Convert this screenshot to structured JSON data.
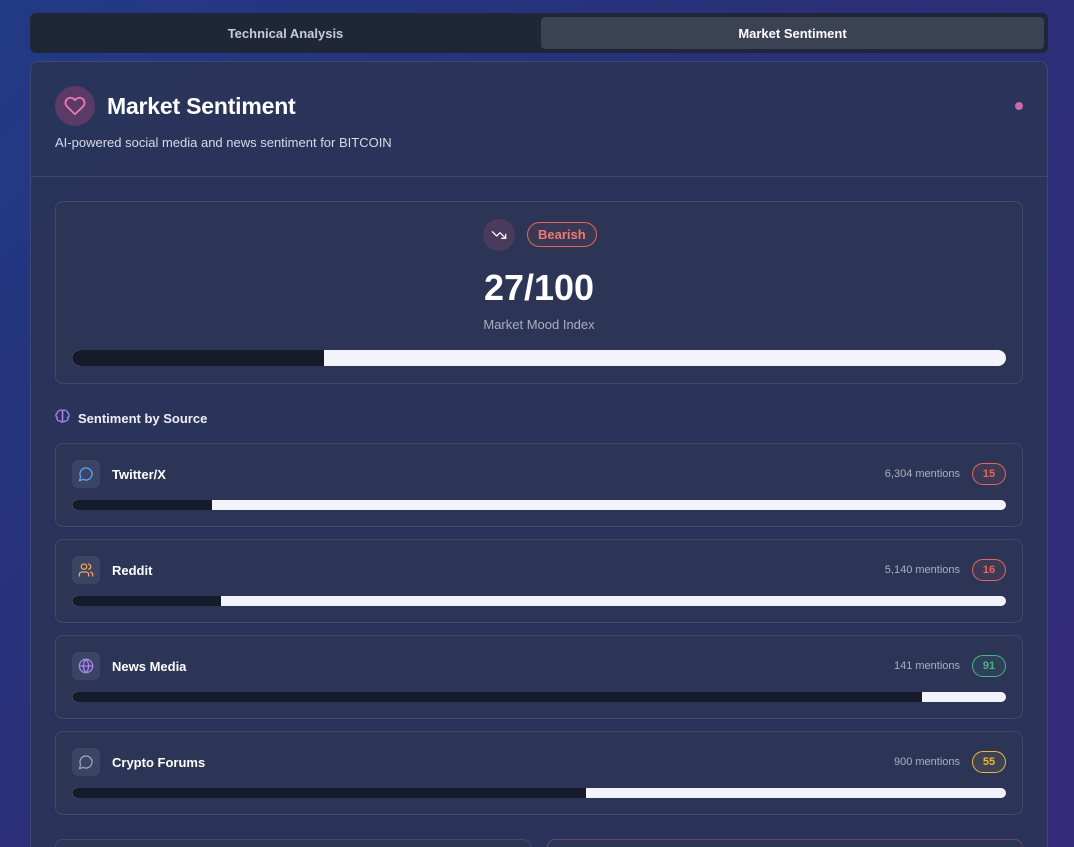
{
  "tabs": [
    {
      "label": "Technical Analysis",
      "active": false
    },
    {
      "label": "Market Sentiment",
      "active": true
    }
  ],
  "header": {
    "title": "Market Sentiment",
    "subtitle": "AI-powered social media and news sentiment for BITCOIN",
    "icon": "heart-icon",
    "status_color": "#c86aa8"
  },
  "mood": {
    "badge": "Bearish",
    "score_text": "27/100",
    "score": 27,
    "label": "Market Mood Index",
    "icon": "trending-down-icon"
  },
  "sources_section": {
    "title": "Sentiment by Source",
    "icon": "brain-icon"
  },
  "sources": [
    {
      "name": "Twitter/X",
      "mentions": "6,304 mentions",
      "score": 15,
      "score_text": "15",
      "icon": "message-circle-icon",
      "tone": "negative"
    },
    {
      "name": "Reddit",
      "mentions": "5,140 mentions",
      "score": 16,
      "score_text": "16",
      "icon": "users-icon",
      "tone": "negative"
    },
    {
      "name": "News Media",
      "mentions": "141 mentions",
      "score": 91,
      "score_text": "91",
      "icon": "globe-icon",
      "tone": "positive"
    },
    {
      "name": "Crypto Forums",
      "mentions": "900 mentions",
      "score": 55,
      "score_text": "55",
      "icon": "message-circle-icon",
      "tone": "neutral"
    }
  ],
  "colors": {
    "negative": "#e0675e",
    "positive": "#46b583",
    "neutral": "#e6b83c",
    "bar_fill": "#161b2c",
    "bar_track": "#f2f4f9"
  }
}
